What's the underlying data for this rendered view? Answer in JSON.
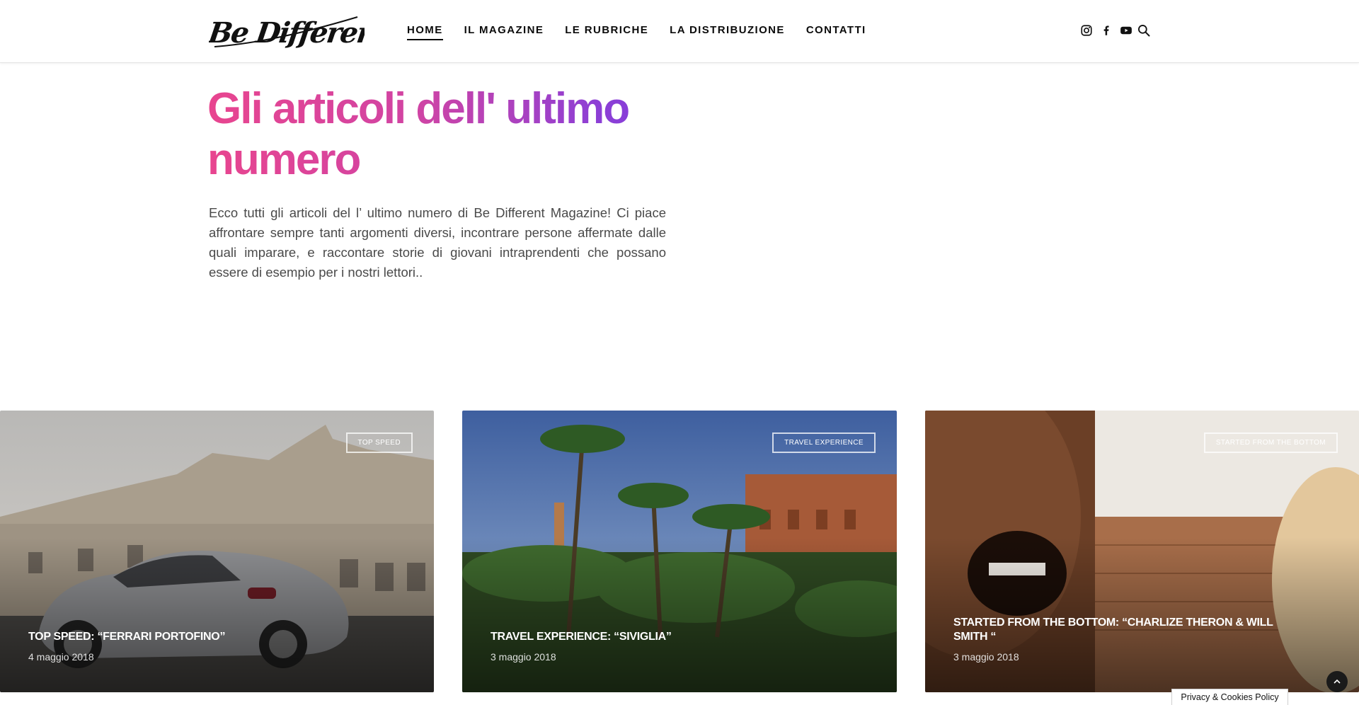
{
  "header": {
    "logo_text": "Be Different",
    "nav": [
      {
        "label": "HOME",
        "active": true
      },
      {
        "label": "IL MAGAZINE",
        "active": false
      },
      {
        "label": "LE RUBRICHE",
        "active": false
      },
      {
        "label": "LA DISTRIBUZIONE",
        "active": false
      },
      {
        "label": "CONTATTI",
        "active": false
      }
    ],
    "social_icons": [
      "instagram-icon",
      "facebook-icon",
      "youtube-icon"
    ],
    "search_icon": "search-icon"
  },
  "intro": {
    "title": "Gli articoli dell' ultimo numero",
    "text": "Ecco tutti gli articoli del l’ ultimo numero di Be Different Magazine! Ci piace affrontare sempre tanti argomenti diversi, incontrare persone affermate dalle quali imparare, e raccontare storie di giovani intraprendenti che possano essere di esempio per i nostri lettori..",
    "gradient_colors": [
      "#e8458f",
      "#8c3fd6"
    ]
  },
  "articles": [
    {
      "tag": "TOP SPEED",
      "title": "TOP SPEED: “FERRARI PORTOFINO”",
      "date": "4 maggio 2018"
    },
    {
      "tag": "TRAVEL EXPERIENCE",
      "title": "TRAVEL EXPERIENCE: “SIVIGLIA”",
      "date": "3 maggio 2018"
    },
    {
      "tag": "STARTED FROM THE BOTTOM",
      "title": "STARTED FROM THE BOTTOM: “CHARLIZE THERON & WILL SMITH “",
      "date": "3 maggio 2018"
    }
  ],
  "footer": {
    "privacy_label": "Privacy & Cookies Policy",
    "back_to_top_icon": "chevron-up-icon"
  }
}
